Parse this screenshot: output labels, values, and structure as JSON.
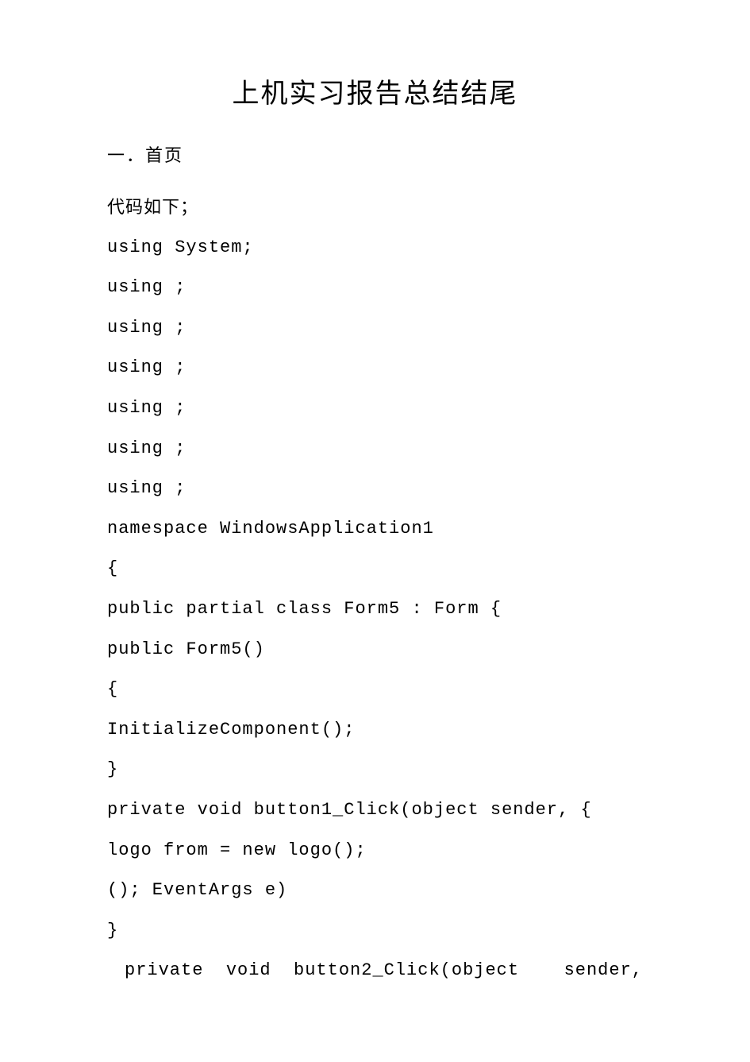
{
  "title": "上机实习报告总结结尾",
  "section_heading": "一．首页",
  "lines": {
    "l0": "代码如下；",
    "l1": "using System;",
    "l2": "using ;",
    "l3": "using ;",
    "l4": "using ;",
    "l5": "using ;",
    "l6": "using ;",
    "l7": "using ;",
    "l8": "namespace WindowsApplication1",
    "l9": "{",
    "l10": "public partial class Form5 : Form {",
    "l11": "public Form5()",
    "l12": "{",
    "l13": "InitializeComponent();",
    "l14": "}",
    "l15": "private void button1_Click(object sender, {",
    "l16": "logo from = new logo();",
    "l17": "(); EventArgs e)",
    "l18": "}",
    "l19_left": "private  void  button2_Click(object",
    "l19_right": "sender,"
  }
}
